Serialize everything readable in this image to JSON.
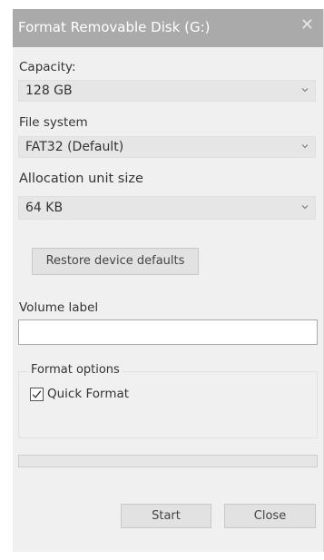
{
  "window": {
    "title": "Format Removable Disk (G:)",
    "close_glyph": "✕"
  },
  "capacity": {
    "label": "Capacity:",
    "value": "128 GB"
  },
  "file_system": {
    "label": "File system",
    "value": "FAT32 (Default)"
  },
  "allocation": {
    "label": "Allocation unit size",
    "value": "64 KB"
  },
  "restore_button": {
    "label": "Restore device defaults"
  },
  "volume": {
    "label": "Volume label",
    "value": ""
  },
  "format_options": {
    "title": "Format options",
    "quick_format_label": "Quick Format",
    "quick_format_checked": true
  },
  "progress": {
    "fraction": 0
  },
  "buttons": {
    "start": "Start",
    "close": "Close"
  },
  "icons": {
    "close": "close-icon",
    "chevron": "chevron-down-icon",
    "check": "checkmark-icon"
  }
}
